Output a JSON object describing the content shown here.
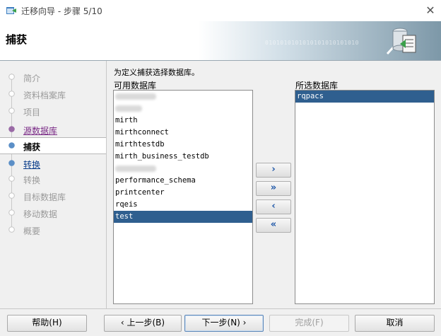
{
  "window": {
    "title": "迁移向导 - 步骤 5/10"
  },
  "header": {
    "title": "捕获",
    "binary_text": "0101010101010101010101010"
  },
  "nav": {
    "items": [
      {
        "label": "简介",
        "state": "disabled"
      },
      {
        "label": "资料档案库",
        "state": "disabled"
      },
      {
        "label": "项目",
        "state": "disabled"
      },
      {
        "label": "源数据库",
        "state": "link-purple"
      },
      {
        "label": "捕获",
        "state": "active"
      },
      {
        "label": "转换",
        "state": "link-blue"
      },
      {
        "label": "转换",
        "state": "disabled"
      },
      {
        "label": "目标数据库",
        "state": "disabled"
      },
      {
        "label": "移动数据",
        "state": "disabled"
      },
      {
        "label": "概要",
        "state": "disabled"
      }
    ]
  },
  "main": {
    "instruction": "为定义捕获选择数据库。",
    "available_label": "可用数据库",
    "selected_label": "所选数据库",
    "available": [
      {
        "text": "",
        "blurred": true
      },
      {
        "text": "",
        "blurred": true
      },
      {
        "text": "mirth"
      },
      {
        "text": "mirthconnect"
      },
      {
        "text": "mirthtestdb"
      },
      {
        "text": "mirth_business_testdb"
      },
      {
        "text": "",
        "blurred": true
      },
      {
        "text": "performance_schema"
      },
      {
        "text": "printcenter"
      },
      {
        "text": "rqeis"
      },
      {
        "text": "test",
        "selected": true
      }
    ],
    "selected": [
      {
        "text": "rqpacs",
        "selected": true
      }
    ],
    "move_buttons": [
      {
        "glyph": "›",
        "name": "move-right-button"
      },
      {
        "glyph": "»",
        "name": "move-all-right-button"
      },
      {
        "glyph": "‹",
        "name": "move-left-button"
      },
      {
        "glyph": "«",
        "name": "move-all-left-button"
      }
    ]
  },
  "footer": {
    "help": "帮助(H)",
    "back": "‹ 上一步(B)",
    "next": "下一步(N) ›",
    "finish": "完成(F)",
    "cancel": "取消"
  },
  "colors": {
    "selection": "#2f5f8f",
    "link_purple": "#7a2a86",
    "link_blue": "#0a3d8a"
  }
}
